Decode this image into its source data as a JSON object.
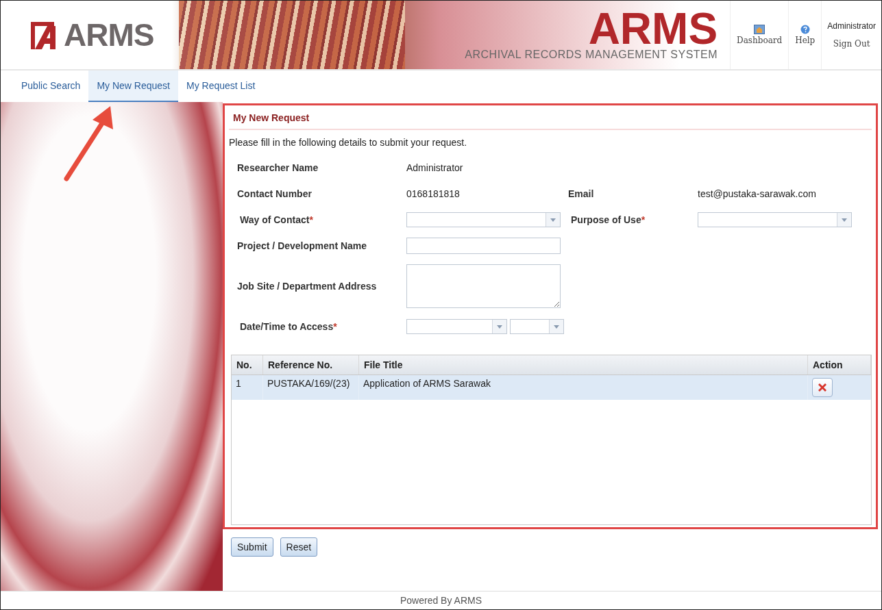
{
  "header": {
    "logo": "ARMS",
    "title": "ARMS",
    "subtitle": "ARCHIVAL RECORDS MANAGEMENT SYSTEM",
    "links": [
      {
        "kind": "dashboard",
        "label": "Dashboard"
      },
      {
        "kind": "help",
        "label": "Help"
      }
    ],
    "user": {
      "name": "Administrator",
      "sign_out": "Sign Out"
    }
  },
  "tabs": [
    {
      "label": "Public Search",
      "selected": false
    },
    {
      "label": "My New Request",
      "selected": true
    },
    {
      "label": "My Request List",
      "selected": false
    }
  ],
  "panel": {
    "title": "My New Request",
    "intro": "Please fill in the following details to submit your request.",
    "required_mark": "*",
    "info_rows": [
      [
        {
          "label": "Researcher Name",
          "value": "Administrator"
        }
      ],
      [
        {
          "label": "Contact Number",
          "value": "0168181818"
        },
        {
          "label": "Email",
          "value": "test@pustaka-sarawak.com"
        }
      ]
    ],
    "fields": [
      [
        {
          "kind": "select",
          "label": "Way of Contact",
          "required": true
        },
        {
          "kind": "select",
          "label": "Purpose of Use",
          "required": true
        }
      ],
      [
        {
          "kind": "text",
          "label": "Project / Development Name",
          "required": false
        }
      ],
      [
        {
          "kind": "textarea",
          "label": "Job Site / Department Address",
          "required": false
        }
      ],
      [
        {
          "kind": "datetime",
          "label": "Date/Time to Access",
          "required": true
        }
      ]
    ],
    "table": {
      "columns": [
        "No.",
        "Reference No.",
        "File Title",
        "Action"
      ],
      "rows": [
        {
          "no": "1",
          "reference": "PUSTAKA/169/(23)",
          "title": "Application of ARMS Sarawak",
          "selected": true
        }
      ]
    }
  },
  "buttons": [
    "Submit",
    "Reset"
  ],
  "footer": "Powered By ARMS"
}
